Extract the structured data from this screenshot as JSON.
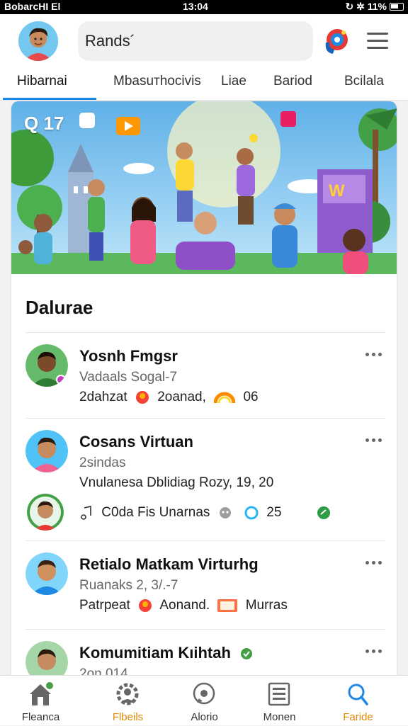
{
  "status_bar": {
    "left": "BobarcНI El",
    "time": "13:04",
    "right": "↻ ✲ 11%"
  },
  "search": {
    "value": "Rands´"
  },
  "tabs": [
    {
      "label": "Hibarnai",
      "active": true
    },
    {
      "label": "Mbasuтhocivis"
    },
    {
      "label": "Liae"
    },
    {
      "label": "Bariod"
    },
    {
      "label": "Bcilala"
    }
  ],
  "banner": {
    "badge": "Q 17"
  },
  "section": {
    "title": "Dalurae"
  },
  "items": [
    {
      "name": "Yosnh Fmgsr",
      "sub": "Vadaals Sogal-7",
      "meta_a": "2dahzat",
      "meta_b": "2oanad,",
      "meta_c": "06"
    },
    {
      "name": "Cosans Virtuan",
      "sub": "2sindas",
      "meta_a": "Vnulanesa Dblidiag Rozy, 19, 20",
      "meta_b": "C0da Fis Unarnas",
      "meta_c": "25"
    },
    {
      "name": "Retialo Matkam Virturhg",
      "sub": "Ruanaks 2, 3/.-7",
      "meta_a": "Patrpeat",
      "meta_b": "Aonand.",
      "meta_c": "Murras"
    },
    {
      "name": "Komumitiam Kıihtah",
      "sub": "2on 014"
    }
  ],
  "bottom_nav": [
    {
      "label": "Fleanca",
      "icon": "home-icon"
    },
    {
      "label": "Flbeils",
      "icon": "gear-people-icon",
      "active": true
    },
    {
      "label": "Alorio",
      "icon": "chat-icon"
    },
    {
      "label": "Monen",
      "icon": "list-icon"
    },
    {
      "label": "Faride",
      "icon": "search-icon",
      "active": true
    }
  ],
  "colors": {
    "accent": "#1e88e5",
    "active_orange": "#e08a00",
    "active_blue": "#1e88e5"
  }
}
